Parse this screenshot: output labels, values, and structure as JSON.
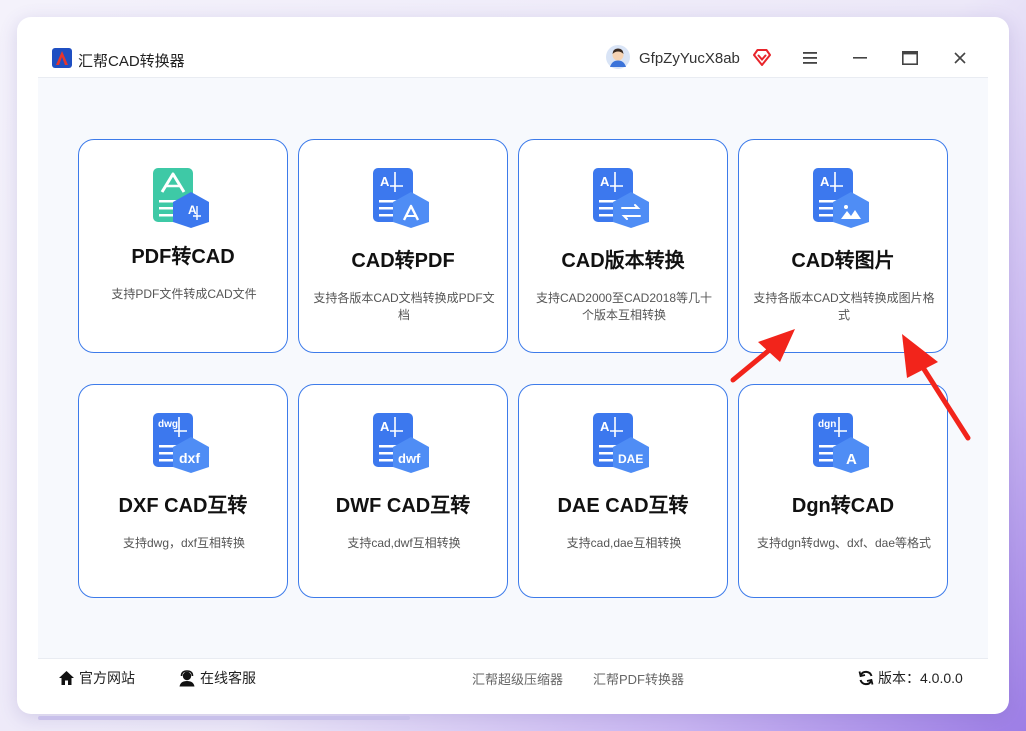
{
  "window": {
    "title": "汇帮CAD转换器",
    "username": "GfpZyYucX8ab"
  },
  "tools": [
    {
      "title": "PDF转CAD",
      "desc": "支持PDF文件转成CAD文件",
      "icon": "pdf-to-cad-icon",
      "badge": ""
    },
    {
      "title": "CAD转PDF",
      "desc": "支持各版本CAD文档转换成PDF文档",
      "icon": "cad-to-pdf-icon",
      "badge": ""
    },
    {
      "title": "CAD版本转换",
      "desc": "支持CAD2000至CAD2018等几十个版本互相转换",
      "icon": "cad-version-convert-icon",
      "badge": ""
    },
    {
      "title": "CAD转图片",
      "desc": "支持各版本CAD文档转换成图片格式",
      "icon": "cad-to-image-icon",
      "badge": ""
    },
    {
      "title": "DXF CAD互转",
      "desc": "支持dwg，dxf互相转换",
      "icon": "dxf-convert-icon",
      "badge": "dxf",
      "tag": "dwg"
    },
    {
      "title": "DWF CAD互转",
      "desc": "支持cad,dwf互相转换",
      "icon": "dwf-convert-icon",
      "badge": "dwf"
    },
    {
      "title": "DAE CAD互转",
      "desc": "支持cad,dae互相转换",
      "icon": "dae-convert-icon",
      "badge": "DAE"
    },
    {
      "title": "Dgn转CAD",
      "desc": "支持dgn转dwg、dxf、dae等格式",
      "icon": "dgn-convert-icon",
      "badge": "A",
      "tag": "dgn"
    }
  ],
  "footer": {
    "website": "官方网站",
    "support": "在线客服",
    "link1": "汇帮超级压缩器",
    "link2": "汇帮PDF转换器",
    "version": "版本：4.0.0.0"
  },
  "colors": {
    "accent": "#3d7bea",
    "arrow": "#f2241b",
    "icon_green": "#3ec9a6",
    "icon_blue": "#3c78ee"
  }
}
